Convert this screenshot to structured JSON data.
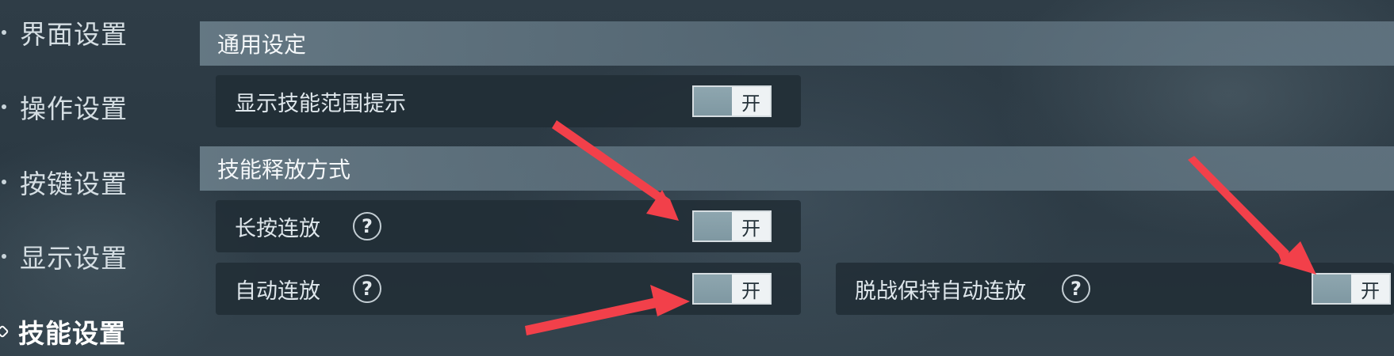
{
  "sidebar": {
    "items": [
      {
        "label": "界面设置"
      },
      {
        "label": "操作设置"
      },
      {
        "label": "按键设置"
      },
      {
        "label": "显示设置"
      },
      {
        "label": "技能设置"
      }
    ]
  },
  "sections": {
    "general": {
      "title": "通用设定",
      "rows": {
        "skill_range_hint": {
          "label": "显示技能范围提示",
          "toggle_text": "开"
        }
      }
    },
    "cast_mode": {
      "title": "技能释放方式",
      "rows": {
        "long_press": {
          "label": "长按连放",
          "help": "?",
          "toggle_text": "开"
        },
        "auto_cast": {
          "label": "自动连放",
          "help": "?",
          "toggle_text": "开"
        },
        "keep_auto_out_of_combat": {
          "label": "脱战保持自动连放",
          "help": "?",
          "toggle_text": "开"
        }
      }
    }
  },
  "colors": {
    "annotation_arrow": "#f2404a",
    "toggle_knob": "#88a0a9"
  },
  "annotations": {
    "arrows": 4
  }
}
